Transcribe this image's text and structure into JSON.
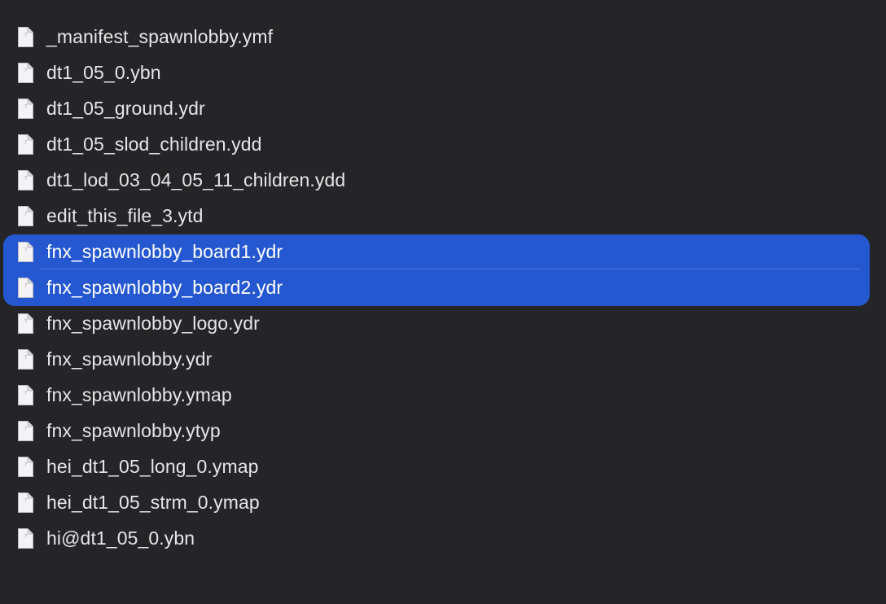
{
  "files": [
    {
      "name": "_manifest_spawnlobby.ymf",
      "selected": false,
      "icon": "document-icon"
    },
    {
      "name": "dt1_05_0.ybn",
      "selected": false,
      "icon": "document-icon"
    },
    {
      "name": "dt1_05_ground.ydr",
      "selected": false,
      "icon": "document-icon"
    },
    {
      "name": "dt1_05_slod_children.ydd",
      "selected": false,
      "icon": "document-icon"
    },
    {
      "name": "dt1_lod_03_04_05_11_children.ydd",
      "selected": false,
      "icon": "document-icon"
    },
    {
      "name": "edit_this_file_3.ytd",
      "selected": false,
      "icon": "document-icon"
    },
    {
      "name": "fnx_spawnlobby_board1.ydr",
      "selected": true,
      "icon": "document-icon"
    },
    {
      "name": "fnx_spawnlobby_board2.ydr",
      "selected": true,
      "icon": "document-icon"
    },
    {
      "name": "fnx_spawnlobby_logo.ydr",
      "selected": false,
      "icon": "document-icon"
    },
    {
      "name": "fnx_spawnlobby.ydr",
      "selected": false,
      "icon": "document-icon"
    },
    {
      "name": "fnx_spawnlobby.ymap",
      "selected": false,
      "icon": "document-icon"
    },
    {
      "name": "fnx_spawnlobby.ytyp",
      "selected": false,
      "icon": "document-icon"
    },
    {
      "name": "hei_dt1_05_long_0.ymap",
      "selected": false,
      "icon": "document-icon"
    },
    {
      "name": "hei_dt1_05_strm_0.ymap",
      "selected": false,
      "icon": "document-icon"
    },
    {
      "name": "hi@dt1_05_0.ybn",
      "selected": false,
      "icon": "document-icon"
    }
  ],
  "colors": {
    "background": "#252528",
    "selection": "#2558d0",
    "text": "#e6e6e8"
  }
}
